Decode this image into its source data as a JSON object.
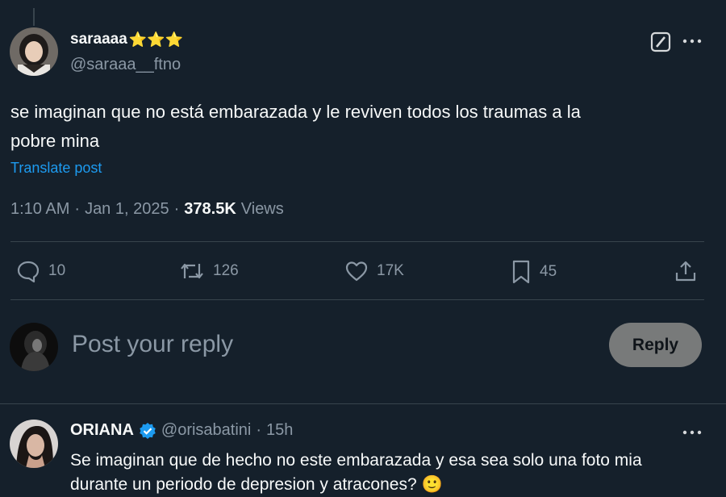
{
  "post": {
    "author_name": "saraaaa",
    "author_name_suffix": "⭐⭐⭐",
    "author_handle": "@saraaa__ftno",
    "text_line1": "se imaginan que no está embarazada y le reviven todos los traumas a la",
    "text_line2": "pobre mina",
    "translate_label": "Translate post",
    "time": "1:10 AM",
    "date": "Jan 1, 2025",
    "dot": "·",
    "views_count": "378.5K",
    "views_label": "Views"
  },
  "actions": {
    "replies": "10",
    "reposts": "126",
    "likes": "17K",
    "bookmarks": "45"
  },
  "composer": {
    "placeholder": "Post your reply",
    "reply_button": "Reply"
  },
  "reply": {
    "author_name": "ORIANA",
    "author_handle": "@orisabatini",
    "dot": "·",
    "time": "15h",
    "text_line1": "Se imaginan que de hecho no este embarazada y esa sea solo una foto mia",
    "text_line2": "durante un periodo de depresion y atracones? 🙂"
  },
  "colors": {
    "background": "#15202b",
    "link": "#1d9bf0",
    "verified": "#1d9bf0",
    "muted": "#8b98a5",
    "reply_button_bg": "#787a7a"
  }
}
